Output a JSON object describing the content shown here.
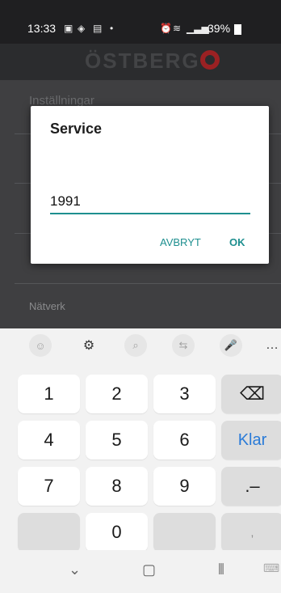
{
  "status": {
    "time": "13:33",
    "battery": "39%"
  },
  "header": {
    "logo_text": "ÖSTBERG"
  },
  "screen": {
    "settings_title": "Inställningar",
    "network_label": "Nätverk"
  },
  "dialog": {
    "title": "Service",
    "input_value": "1991",
    "cancel_label": "AVBRYT",
    "ok_label": "OK"
  },
  "keyboard": {
    "keys": [
      "1",
      "2",
      "3",
      "4",
      "5",
      "6",
      "7",
      "8",
      "9",
      "0"
    ],
    "punct_label": ".–",
    "comma_label": ",",
    "done_label": "Klar",
    "toolbar": [
      "emoji-icon",
      "settings-icon",
      "search-icon",
      "translate-icon",
      "mic-icon",
      "more-icon"
    ]
  },
  "colors": {
    "accent": "#1e8f8f",
    "brand": "#9b2123",
    "done": "#2a7bd8"
  }
}
